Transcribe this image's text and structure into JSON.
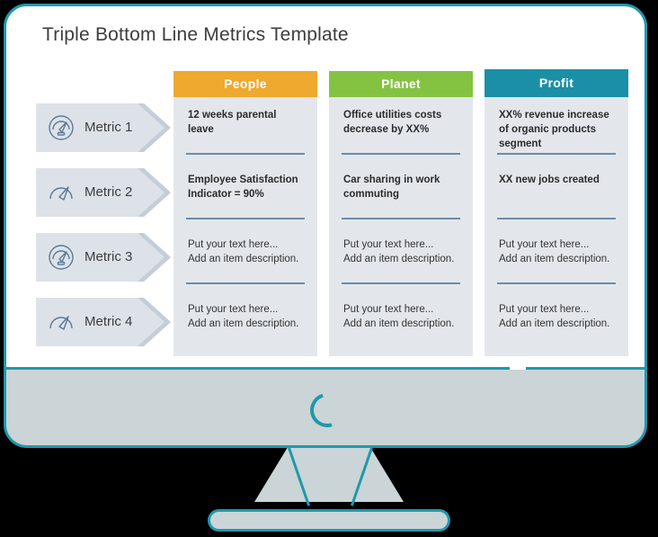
{
  "slide": {
    "title": "Triple Bottom Line Metrics Template"
  },
  "metrics": [
    {
      "label": "Metric 1",
      "icon": "gauge-circle-icon"
    },
    {
      "label": "Metric 2",
      "icon": "gauge-open-icon"
    },
    {
      "label": "Metric 3",
      "icon": "gauge-circle-icon"
    },
    {
      "label": "Metric 4",
      "icon": "gauge-open-icon"
    }
  ],
  "columns": [
    {
      "header": "People",
      "color": "#efa92e",
      "cells": [
        {
          "text": "12 weeks parental leave",
          "style": "bold"
        },
        {
          "text": "Employee Satisfaction Indicator = 90%",
          "style": "bold"
        },
        {
          "text": "Put your text here...\nAdd an item description.",
          "style": "plain"
        },
        {
          "text": "Put your text here...\nAdd an item description.",
          "style": "plain"
        }
      ]
    },
    {
      "header": "Planet",
      "color": "#84c341",
      "cells": [
        {
          "text": "Office utilities costs decrease by XX%",
          "style": "bold"
        },
        {
          "text": "Car sharing in work commuting",
          "style": "bold"
        },
        {
          "text": "Put your text here...\nAdd an item description.",
          "style": "plain"
        },
        {
          "text": "Put your text here...\nAdd an item description.",
          "style": "plain"
        }
      ]
    },
    {
      "header": "Profit",
      "color": "#1a8fa6",
      "cells": [
        {
          "text": "XX% revenue increase of organic products segment",
          "style": "bold"
        },
        {
          "text": "XX new jobs created",
          "style": "bold"
        },
        {
          "text": "Put your text here...\nAdd an item description.",
          "style": "plain"
        },
        {
          "text": "Put your text here...\nAdd an item description.",
          "style": "plain"
        }
      ]
    }
  ],
  "monitor": {
    "frame_color": "#1f99ab",
    "body_color": "#cbd4d6",
    "screen_color": "#ffffff",
    "spinner": "loading-spinner"
  }
}
